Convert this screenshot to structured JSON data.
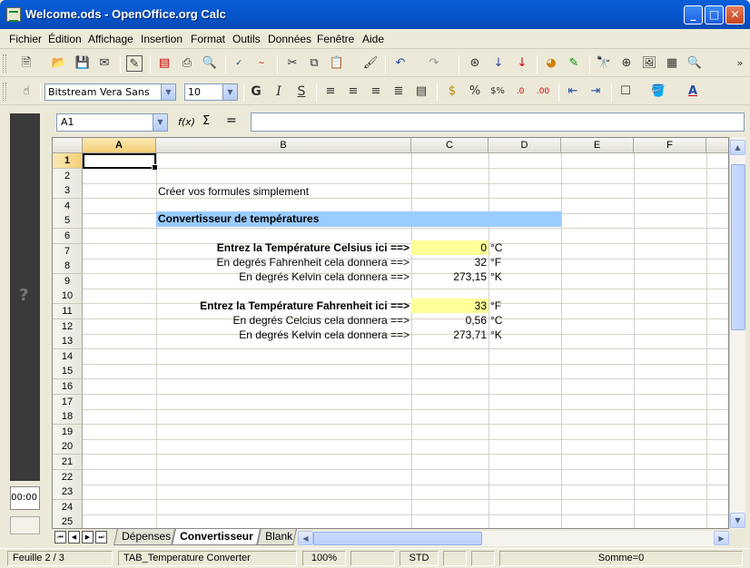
{
  "window": {
    "title": "Welcome.ods - OpenOffice.org Calc"
  },
  "menu": [
    "Fichier",
    "Édition",
    "Affichage",
    "Insertion",
    "Format",
    "Outils",
    "Données",
    "Fenêtre",
    "Aide"
  ],
  "format_toolbar": {
    "font_name": "Bitstream Vera Sans",
    "font_size": "10",
    "bold": "G",
    "italic": "I",
    "underline": "S"
  },
  "formula_bar": {
    "name_box": "A1",
    "fx_label": "f(x)",
    "sum_label": "Σ",
    "equal_label": "=",
    "input": ""
  },
  "side_panel": {
    "help": "?",
    "time": "00:00"
  },
  "columns": [
    "A",
    "B",
    "C",
    "D",
    "E",
    "F"
  ],
  "rows": [
    "1",
    "2",
    "3",
    "4",
    "5",
    "6",
    "7",
    "8",
    "9",
    "10",
    "11",
    "12",
    "13",
    "14",
    "15",
    "16",
    "17",
    "18",
    "19",
    "20",
    "21",
    "22",
    "23",
    "24",
    "25"
  ],
  "cells": {
    "b3": "Créer vos formules simplement",
    "b5": "Convertisseur de températures",
    "b7": "Entrez la Température Celsius ici ==>",
    "c7": "0",
    "d7": "°C",
    "b8": "En degrés Fahrenheit cela donnera  ==>",
    "c8": "32",
    "d8": "°F",
    "b9": "En degrés Kelvin cela donnera ==>",
    "c9": "273,15",
    "d9": "°K",
    "b11": "Entrez la Température Fahrenheit ici ==>",
    "c11": "33",
    "d11": "°F",
    "b12": "En degrés Celcius cela donnera  ==>",
    "c12": "0,56",
    "d12": "°C",
    "b13": "En degrés Kelvin cela donnera ==>",
    "c13": "273,71",
    "d13": "°K"
  },
  "colors": {
    "input_fill": "#FFFF99",
    "header_fill": "#99CCFF",
    "title_bar": "#0553C9"
  },
  "sheets": [
    "Dépenses",
    "Convertisseur",
    "Blank"
  ],
  "active_sheet": "Convertisseur",
  "status": {
    "sheet": "Feuille 2 / 3",
    "page_style": "TAB_Temperature Converter",
    "zoom": "100%",
    "mode": "STD",
    "sum": "Somme=0"
  }
}
